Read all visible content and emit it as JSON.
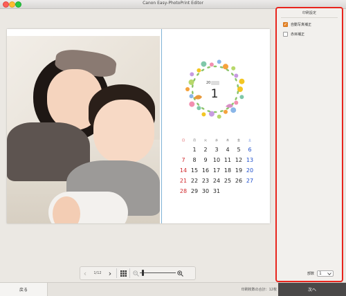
{
  "window": {
    "title": "Canon Easy-PhotoPrint Editor"
  },
  "calendar": {
    "year_prefix": "20",
    "month": "1",
    "weekdays": [
      "日",
      "月",
      "火",
      "水",
      "木",
      "金",
      "土"
    ],
    "weeks": [
      [
        "",
        "1",
        "2",
        "3",
        "4",
        "5",
        "6"
      ],
      [
        "7",
        "8",
        "9",
        "10",
        "11",
        "12",
        "13"
      ],
      [
        "14",
        "15",
        "16",
        "17",
        "18",
        "19",
        "20"
      ],
      [
        "21",
        "22",
        "23",
        "24",
        "25",
        "26",
        "27"
      ],
      [
        "28",
        "29",
        "30",
        "31",
        "",
        "",
        ""
      ]
    ]
  },
  "toolbar": {
    "page_indicator": "1/12",
    "prev_icon": "chevron-left-icon",
    "next_icon": "chevron-right-icon",
    "zoom_level": 0.05
  },
  "panel": {
    "title": "印刷設定",
    "options": [
      {
        "label": "自動写真補正",
        "checked": true
      },
      {
        "label": "赤目補正",
        "checked": false
      }
    ],
    "copies_label": "部数",
    "copies_value": "1"
  },
  "bottom": {
    "back_label": "戻る",
    "total_label": "印刷枚数の合計：12枚",
    "next_label": "次へ"
  },
  "colors": {
    "highlight_border": "#e8241c",
    "checkbox_on": "#e8862a",
    "next_button": "#4a4848"
  }
}
